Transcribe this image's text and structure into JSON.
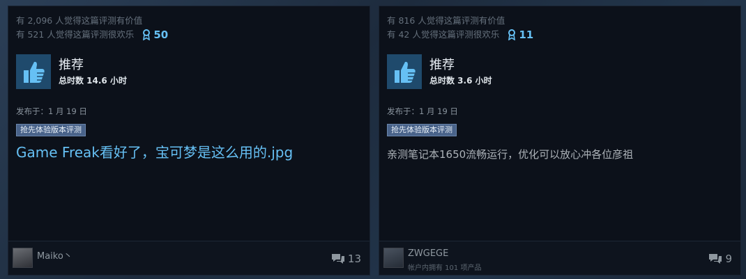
{
  "reviews": [
    {
      "helpful": "有 2,096 人觉得这篇评测有价值",
      "funny": "有 521 人觉得这篇评测很欢乐",
      "awards": "50",
      "recommendation": "推荐",
      "hours": "总时数 14.6 小时",
      "posted": "发布于：1 月 19 日",
      "badge": "抢先体验版本评测",
      "content": "Game Freak看好了，宝可梦是这么用的.jpg",
      "username": "Maiko丶",
      "products_owned": "",
      "comments": "13"
    },
    {
      "helpful": "有 816 人觉得这篇评测有价值",
      "funny": "有 42 人觉得这篇评测很欢乐",
      "awards": "11",
      "recommendation": "推荐",
      "hours": "总时数 3.6 小时",
      "posted": "发布于：1 月 19 日",
      "badge": "抢先体验版本评测",
      "content": "亲测笔记本1650流畅运行，优化可以放心冲各位彦祖",
      "username": "ZWGEGE",
      "products_owned": "帐户内拥有 101 项产品",
      "comments": "9"
    }
  ],
  "icons": {
    "award": "award-ribbon-icon",
    "thumb": "thumbs-up-icon",
    "comment": "comment-bubble-icon"
  },
  "colors": {
    "accent": "#66c0f4",
    "card_bg": "#0c111a",
    "thumb_bg": "#1f4a6c",
    "badge_bg": "#49638a"
  }
}
